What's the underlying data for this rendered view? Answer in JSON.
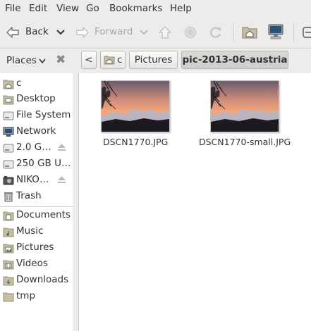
{
  "menubar": {
    "items": [
      {
        "label": "File",
        "name": "menu-file"
      },
      {
        "label": "Edit",
        "name": "menu-edit"
      },
      {
        "label": "View",
        "name": "menu-view"
      },
      {
        "label": "Go",
        "name": "menu-go"
      },
      {
        "label": "Bookmarks",
        "name": "menu-bookmarks"
      },
      {
        "label": "Help",
        "name": "menu-help"
      }
    ]
  },
  "toolbar": {
    "back_label": "Back",
    "forward_label": "Forward",
    "icons": [
      "back-arrow-icon",
      "chevron-down-icon",
      "forward-arrow-icon",
      "up-arrow-icon",
      "stop-icon",
      "reload-icon",
      "home-folder-icon",
      "computer-icon"
    ]
  },
  "location": {
    "places_label": "Places",
    "close_glyph": "✖",
    "back_glyph": "<",
    "crumbs": [
      "c",
      "Pictures",
      "pic-2013-06-austria"
    ]
  },
  "sidebar": {
    "items": [
      {
        "label": "c",
        "icon": "home-folder-icon"
      },
      {
        "label": "Desktop",
        "icon": "desktop-folder-icon"
      },
      {
        "label": "File System",
        "icon": "drive-icon"
      },
      {
        "label": "Network",
        "icon": "network-icon"
      },
      {
        "label": "2.0 G…",
        "icon": "drive-icon",
        "eject": true
      },
      {
        "label": "250 GB U…",
        "icon": "drive-icon"
      },
      {
        "label": "NIKO…",
        "icon": "camera-icon",
        "eject": true
      },
      {
        "label": "Trash",
        "icon": "trash-icon"
      },
      {
        "label": "Documents",
        "icon": "documents-folder-icon"
      },
      {
        "label": "Music",
        "icon": "music-folder-icon"
      },
      {
        "label": "Pictures",
        "icon": "pictures-folder-icon"
      },
      {
        "label": "Videos",
        "icon": "videos-folder-icon"
      },
      {
        "label": "Downloads",
        "icon": "downloads-folder-icon"
      },
      {
        "label": "tmp",
        "icon": "folder-icon"
      }
    ]
  },
  "files": [
    {
      "name": "DSCN1770.JPG"
    },
    {
      "name": "DSCN1770-small.JPG"
    }
  ],
  "colors": {
    "window_bg": "#edeceb",
    "pane_bg": "#ffffff",
    "text": "#2e3436",
    "disabled_text": "#a6a8a4",
    "folder_tan": "#c4bfa3"
  }
}
